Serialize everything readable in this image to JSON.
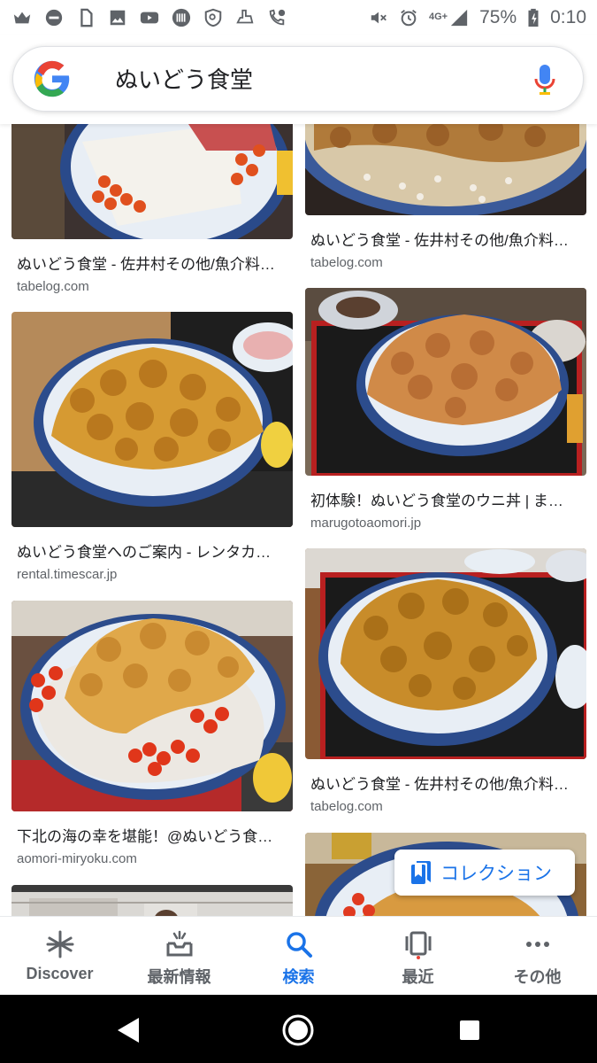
{
  "status_bar": {
    "network": "4G+",
    "battery": "75%",
    "time": "0:10",
    "left_icons": [
      "crown-icon",
      "minus-circle-icon",
      "sim-icon",
      "image-icon",
      "youtube-icon",
      "ticket-icon",
      "shield-icon",
      "alarm-hand-icon",
      "phone-clock-icon"
    ],
    "right_icons": [
      "mute-icon",
      "alarm-icon",
      "signal-icon",
      "battery-icon"
    ]
  },
  "search": {
    "query": "ぬいどう食堂"
  },
  "results": [
    {
      "title": "ぬいどう食堂 - 佐井村その他/魚介料…",
      "source": "tabelog.com"
    },
    {
      "title": "ぬいどう食堂 - 佐井村その他/魚介料…",
      "source": "tabelog.com"
    },
    {
      "title": "ぬいどう食堂へのご案内 - レンタカ…",
      "source": "rental.timescar.jp"
    },
    {
      "title": "初体験！ぬいどう食堂のウニ丼 | ま…",
      "source": "marugotoaomori.jp"
    },
    {
      "title": "下北の海の幸を堪能！@ぬいどう食…",
      "source": "aomori-miryoku.com"
    },
    {
      "title": "ぬいどう食堂 - 佐井村その他/魚介料…",
      "source": "tabelog.com"
    }
  ],
  "collection_button": {
    "label": "コレクション"
  },
  "bottom_nav": [
    {
      "label": "Discover",
      "icon": "asterisk-icon"
    },
    {
      "label": "最新情報",
      "icon": "updates-icon"
    },
    {
      "label": "検索",
      "icon": "search-icon"
    },
    {
      "label": "最近",
      "icon": "recent-icon"
    },
    {
      "label": "その他",
      "icon": "more-icon"
    }
  ],
  "colors": {
    "accent": "#1a73e8",
    "text": "#202124",
    "muted": "#5f6368"
  }
}
